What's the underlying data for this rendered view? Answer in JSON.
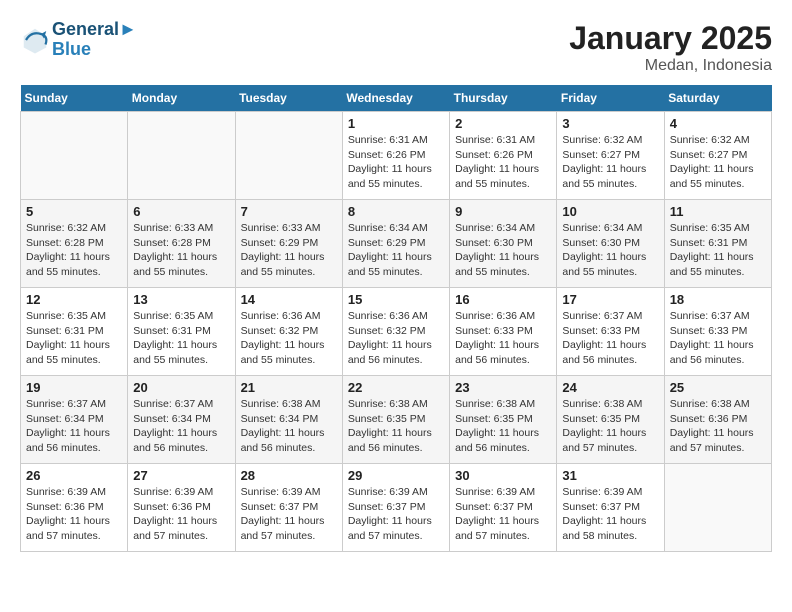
{
  "header": {
    "logo_line1": "General",
    "logo_line2": "Blue",
    "title": "January 2025",
    "subtitle": "Medan, Indonesia"
  },
  "weekdays": [
    "Sunday",
    "Monday",
    "Tuesday",
    "Wednesday",
    "Thursday",
    "Friday",
    "Saturday"
  ],
  "weeks": [
    [
      {
        "day": "",
        "info": ""
      },
      {
        "day": "",
        "info": ""
      },
      {
        "day": "",
        "info": ""
      },
      {
        "day": "1",
        "info": "Sunrise: 6:31 AM\nSunset: 6:26 PM\nDaylight: 11 hours\nand 55 minutes."
      },
      {
        "day": "2",
        "info": "Sunrise: 6:31 AM\nSunset: 6:26 PM\nDaylight: 11 hours\nand 55 minutes."
      },
      {
        "day": "3",
        "info": "Sunrise: 6:32 AM\nSunset: 6:27 PM\nDaylight: 11 hours\nand 55 minutes."
      },
      {
        "day": "4",
        "info": "Sunrise: 6:32 AM\nSunset: 6:27 PM\nDaylight: 11 hours\nand 55 minutes."
      }
    ],
    [
      {
        "day": "5",
        "info": "Sunrise: 6:32 AM\nSunset: 6:28 PM\nDaylight: 11 hours\nand 55 minutes."
      },
      {
        "day": "6",
        "info": "Sunrise: 6:33 AM\nSunset: 6:28 PM\nDaylight: 11 hours\nand 55 minutes."
      },
      {
        "day": "7",
        "info": "Sunrise: 6:33 AM\nSunset: 6:29 PM\nDaylight: 11 hours\nand 55 minutes."
      },
      {
        "day": "8",
        "info": "Sunrise: 6:34 AM\nSunset: 6:29 PM\nDaylight: 11 hours\nand 55 minutes."
      },
      {
        "day": "9",
        "info": "Sunrise: 6:34 AM\nSunset: 6:30 PM\nDaylight: 11 hours\nand 55 minutes."
      },
      {
        "day": "10",
        "info": "Sunrise: 6:34 AM\nSunset: 6:30 PM\nDaylight: 11 hours\nand 55 minutes."
      },
      {
        "day": "11",
        "info": "Sunrise: 6:35 AM\nSunset: 6:31 PM\nDaylight: 11 hours\nand 55 minutes."
      }
    ],
    [
      {
        "day": "12",
        "info": "Sunrise: 6:35 AM\nSunset: 6:31 PM\nDaylight: 11 hours\nand 55 minutes."
      },
      {
        "day": "13",
        "info": "Sunrise: 6:35 AM\nSunset: 6:31 PM\nDaylight: 11 hours\nand 55 minutes."
      },
      {
        "day": "14",
        "info": "Sunrise: 6:36 AM\nSunset: 6:32 PM\nDaylight: 11 hours\nand 55 minutes."
      },
      {
        "day": "15",
        "info": "Sunrise: 6:36 AM\nSunset: 6:32 PM\nDaylight: 11 hours\nand 56 minutes."
      },
      {
        "day": "16",
        "info": "Sunrise: 6:36 AM\nSunset: 6:33 PM\nDaylight: 11 hours\nand 56 minutes."
      },
      {
        "day": "17",
        "info": "Sunrise: 6:37 AM\nSunset: 6:33 PM\nDaylight: 11 hours\nand 56 minutes."
      },
      {
        "day": "18",
        "info": "Sunrise: 6:37 AM\nSunset: 6:33 PM\nDaylight: 11 hours\nand 56 minutes."
      }
    ],
    [
      {
        "day": "19",
        "info": "Sunrise: 6:37 AM\nSunset: 6:34 PM\nDaylight: 11 hours\nand 56 minutes."
      },
      {
        "day": "20",
        "info": "Sunrise: 6:37 AM\nSunset: 6:34 PM\nDaylight: 11 hours\nand 56 minutes."
      },
      {
        "day": "21",
        "info": "Sunrise: 6:38 AM\nSunset: 6:34 PM\nDaylight: 11 hours\nand 56 minutes."
      },
      {
        "day": "22",
        "info": "Sunrise: 6:38 AM\nSunset: 6:35 PM\nDaylight: 11 hours\nand 56 minutes."
      },
      {
        "day": "23",
        "info": "Sunrise: 6:38 AM\nSunset: 6:35 PM\nDaylight: 11 hours\nand 56 minutes."
      },
      {
        "day": "24",
        "info": "Sunrise: 6:38 AM\nSunset: 6:35 PM\nDaylight: 11 hours\nand 57 minutes."
      },
      {
        "day": "25",
        "info": "Sunrise: 6:38 AM\nSunset: 6:36 PM\nDaylight: 11 hours\nand 57 minutes."
      }
    ],
    [
      {
        "day": "26",
        "info": "Sunrise: 6:39 AM\nSunset: 6:36 PM\nDaylight: 11 hours\nand 57 minutes."
      },
      {
        "day": "27",
        "info": "Sunrise: 6:39 AM\nSunset: 6:36 PM\nDaylight: 11 hours\nand 57 minutes."
      },
      {
        "day": "28",
        "info": "Sunrise: 6:39 AM\nSunset: 6:37 PM\nDaylight: 11 hours\nand 57 minutes."
      },
      {
        "day": "29",
        "info": "Sunrise: 6:39 AM\nSunset: 6:37 PM\nDaylight: 11 hours\nand 57 minutes."
      },
      {
        "day": "30",
        "info": "Sunrise: 6:39 AM\nSunset: 6:37 PM\nDaylight: 11 hours\nand 57 minutes."
      },
      {
        "day": "31",
        "info": "Sunrise: 6:39 AM\nSunset: 6:37 PM\nDaylight: 11 hours\nand 58 minutes."
      },
      {
        "day": "",
        "info": ""
      }
    ]
  ]
}
